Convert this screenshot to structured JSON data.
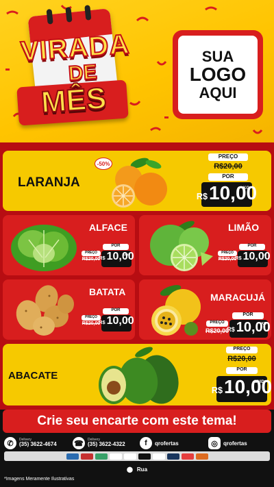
{
  "header": {
    "title_line1": "VIRADA",
    "title_line2": "DE",
    "title_line3": "MÊS",
    "logo_line1": "SUA",
    "logo_line2": "LOGO",
    "logo_line3": "AQUI"
  },
  "labels": {
    "preco": "PREÇO",
    "por": "POR",
    "currency": "R$",
    "unit_kg": "KG",
    "unit_und": "UNID"
  },
  "products": [
    {
      "name": "LARANJA",
      "old_price": "R$20,00",
      "price": "10,00",
      "unit": "KG",
      "badge": "-50%",
      "icon": "orange-icon"
    },
    {
      "name": "ALFACE",
      "old_price": "R$20,00",
      "price": "10,00",
      "unit": "UNID",
      "icon": "lettuce-icon"
    },
    {
      "name": "LIMÃO",
      "old_price": "R$20,00",
      "price": "10,00",
      "unit": "KG",
      "icon": "lime-icon"
    },
    {
      "name": "BATATA",
      "old_price": "R$20,00",
      "price": "10,00",
      "unit": "KG",
      "icon": "potato-icon"
    },
    {
      "name": "MARACUJÁ",
      "old_price": "R$20,00",
      "price": "10,00",
      "unit": "KG",
      "icon": "passion-fruit-icon"
    },
    {
      "name": "ABACATE",
      "old_price": "R$20,00",
      "price": "10,00",
      "unit": "UNID",
      "icon": "avocado-icon"
    }
  ],
  "cta": "Crie seu encarte com este tema!",
  "footer": {
    "delivery_label": "Delivery",
    "phone1": "(35) 3622-4674",
    "phone2": "(35) 3622-4322",
    "facebook": "qrofertas",
    "instagram": "qrofertas",
    "address": "Rua",
    "disclaimer": "*Imagens Meramente Ilustrativas"
  },
  "colors": {
    "red": "#d81e1e",
    "yellow": "#f6c900",
    "dark": "#111111"
  }
}
